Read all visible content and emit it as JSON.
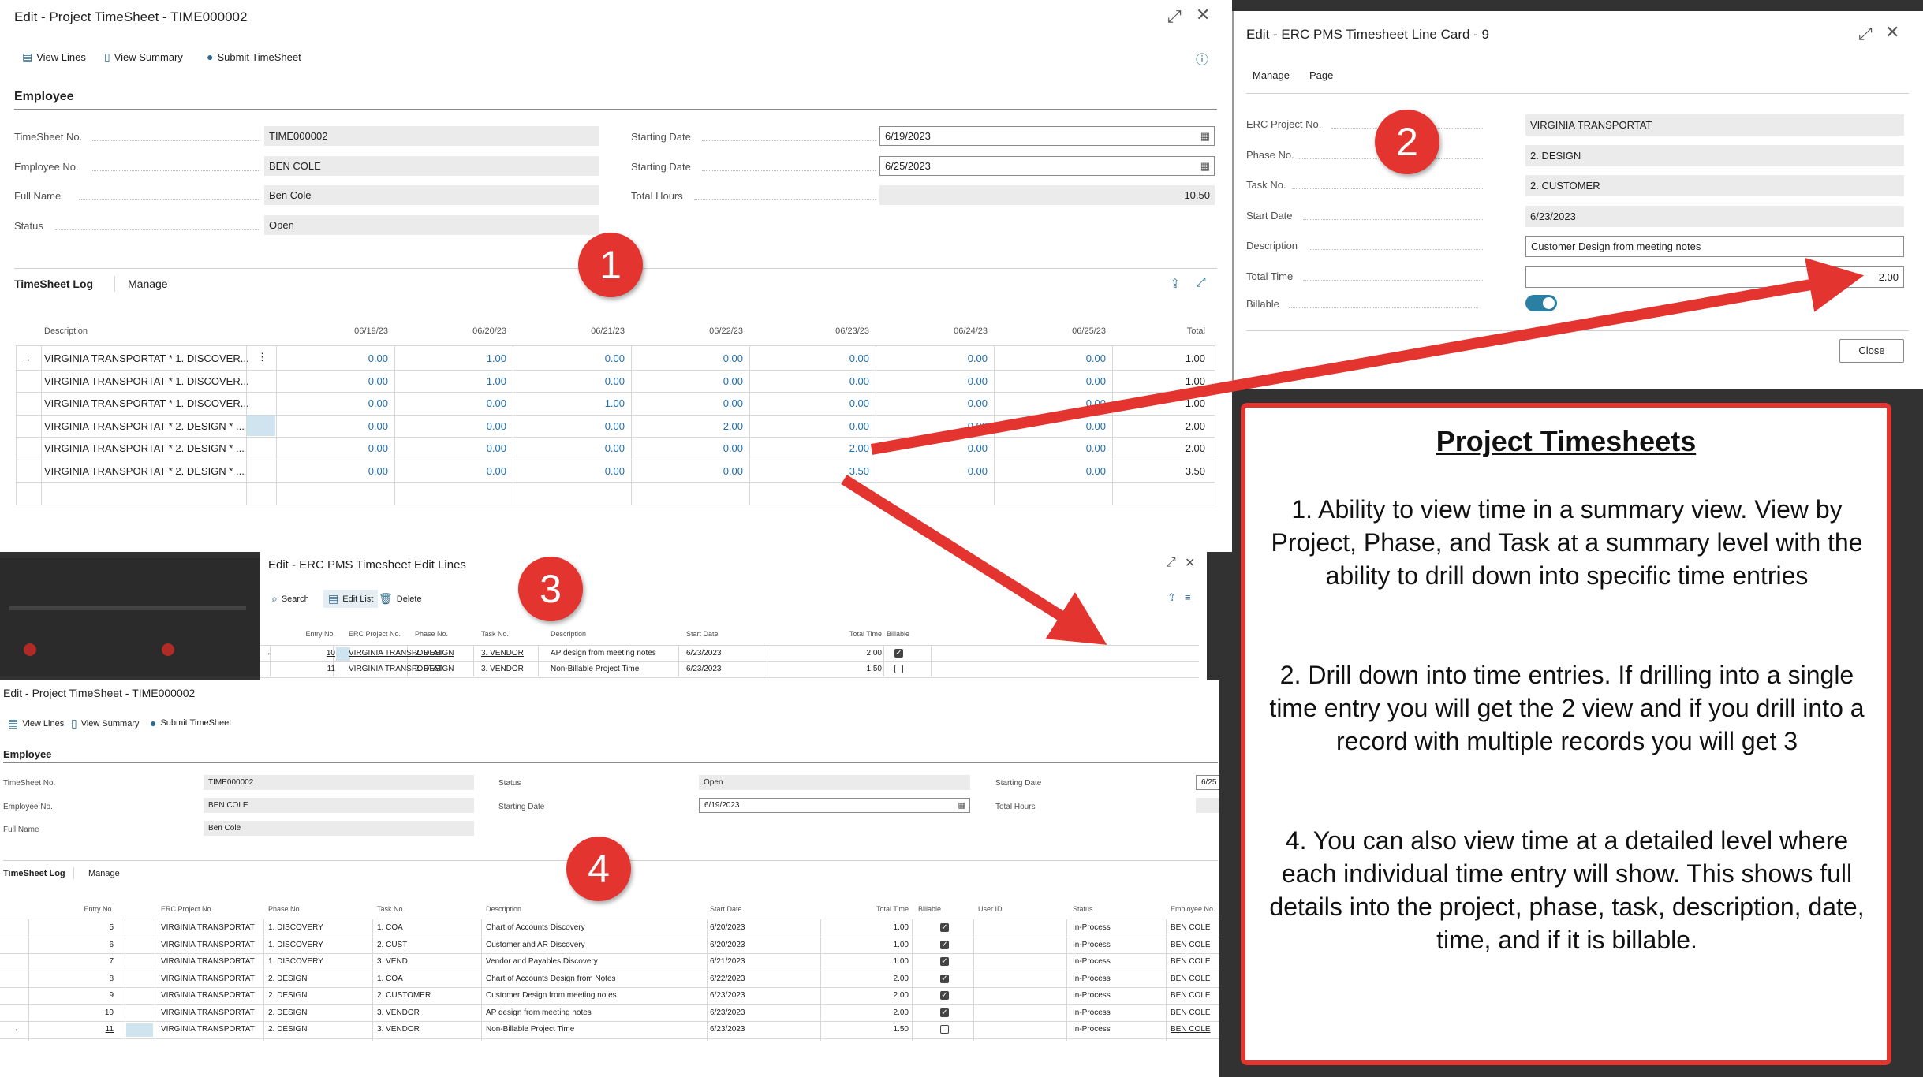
{
  "colors": {
    "accent": "#1f6fb0",
    "badge": "#e3342f",
    "toggle": "#2b7fa3",
    "background": "#323232"
  },
  "panel1": {
    "title": "Edit - Project TimeSheet - TIME000002",
    "actions": [
      "View Lines",
      "View Summary",
      "Submit TimeSheet"
    ],
    "section": "Employee",
    "fields": {
      "timesheet_no_label": "TimeSheet No.",
      "timesheet_no": "TIME000002",
      "employee_no_label": "Employee No.",
      "employee_no": "BEN COLE",
      "full_name_label": "Full Name",
      "full_name": "Ben Cole",
      "status_label": "Status",
      "status": "Open",
      "start1_label": "Starting Date",
      "start1": "6/19/2023",
      "start2_label": "Starting Date",
      "start2": "6/25/2023",
      "total_hours_label": "Total Hours",
      "total_hours": "10.50"
    },
    "tabs": [
      "TimeSheet Log",
      "Manage"
    ],
    "columns": [
      "Description",
      "06/19/23",
      "06/20/23",
      "06/21/23",
      "06/22/23",
      "06/23/23",
      "06/24/23",
      "06/25/23",
      "Total"
    ],
    "rows": [
      {
        "d": "VIRGINIA TRANSPORTAT * 1. DISCOVER...",
        "v": [
          "0.00",
          "1.00",
          "0.00",
          "0.00",
          "0.00",
          "0.00",
          "0.00"
        ],
        "t": "1.00"
      },
      {
        "d": "VIRGINIA TRANSPORTAT * 1. DISCOVER...",
        "v": [
          "0.00",
          "1.00",
          "0.00",
          "0.00",
          "0.00",
          "0.00",
          "0.00"
        ],
        "t": "1.00"
      },
      {
        "d": "VIRGINIA TRANSPORTAT * 1. DISCOVER...",
        "v": [
          "0.00",
          "0.00",
          "1.00",
          "0.00",
          "0.00",
          "0.00",
          "0.00"
        ],
        "t": "1.00"
      },
      {
        "d": "VIRGINIA TRANSPORTAT * 2. DESIGN * ...",
        "v": [
          "0.00",
          "0.00",
          "0.00",
          "2.00",
          "0.00",
          "0.00",
          "0.00"
        ],
        "t": "2.00"
      },
      {
        "d": "VIRGINIA TRANSPORTAT * 2. DESIGN * ...",
        "v": [
          "0.00",
          "0.00",
          "0.00",
          "0.00",
          "2.00",
          "0.00",
          "0.00"
        ],
        "t": "2.00"
      },
      {
        "d": "VIRGINIA TRANSPORTAT * 2. DESIGN * ...",
        "v": [
          "0.00",
          "0.00",
          "0.00",
          "0.00",
          "3.50",
          "0.00",
          "0.00"
        ],
        "t": "3.50"
      }
    ]
  },
  "panel2": {
    "title": "Edit - ERC PMS Timesheet Line Card - 9",
    "actions": [
      "Manage",
      "Page"
    ],
    "fields": [
      {
        "label": "ERC Project No.",
        "value": "VIRGINIA TRANSPORTAT"
      },
      {
        "label": "Phase No.",
        "value": "2. DESIGN"
      },
      {
        "label": "Task No.",
        "value": "2. CUSTOMER"
      },
      {
        "label": "Start Date",
        "value": "6/23/2023"
      },
      {
        "label": "Description",
        "value": "Customer Design from meeting notes"
      },
      {
        "label": "Total Time",
        "value": "2.00"
      }
    ],
    "billable_label": "Billable",
    "billable": true,
    "close": "Close"
  },
  "panel3": {
    "title": "Edit - ERC PMS Timesheet Edit Lines",
    "actions": [
      "Search",
      "Edit List",
      "Delete"
    ],
    "columns": [
      "Entry No.",
      "ERC Project No.",
      "Phase No.",
      "Task No.",
      "Description",
      "Start Date",
      "Total Time",
      "Billable"
    ],
    "rows": [
      {
        "entry": "10",
        "project": "VIRGINIA TRANSPORTAT",
        "phase": "2. DESIGN",
        "task": "3. VENDOR",
        "desc": "AP design from meeting notes",
        "date": "6/23/2023",
        "time": "2.00",
        "billable": true
      },
      {
        "entry": "11",
        "project": "VIRGINIA TRANSPORTAT",
        "phase": "2. DESIGN",
        "task": "3. VENDOR",
        "desc": "Non-Billable Project Time",
        "date": "6/23/2023",
        "time": "1.50",
        "billable": false
      }
    ]
  },
  "panel4": {
    "title": "Edit - Project TimeSheet - TIME000002",
    "actions": [
      "View Lines",
      "View Summary",
      "Submit TimeSheet"
    ],
    "section": "Employee",
    "fields": {
      "timesheet_no_label": "TimeSheet No.",
      "timesheet_no": "TIME000002",
      "employee_no_label": "Employee No.",
      "employee_no": "BEN COLE",
      "full_name_label": "Full Name",
      "full_name": "Ben Cole",
      "status_label": "Status",
      "status": "Open",
      "start_label": "Starting Date",
      "start": "6/19/2023",
      "start2_label": "Starting Date",
      "start2": "6/25",
      "total_hours_label": "Total Hours"
    },
    "tabs": [
      "TimeSheet Log",
      "Manage"
    ],
    "columns": [
      "Entry No.",
      "ERC Project No.",
      "Phase No.",
      "Task No.",
      "Description",
      "Start Date",
      "Total Time",
      "Billable",
      "User ID",
      "Status",
      "Employee No."
    ],
    "rows": [
      {
        "entry": "5",
        "project": "VIRGINIA TRANSPORTAT",
        "phase": "1. DISCOVERY",
        "task": "1. COA",
        "desc": "Chart of Accounts Discovery",
        "date": "6/20/2023",
        "time": "1.00",
        "billable": true,
        "status": "In-Process",
        "emp": "BEN COLE"
      },
      {
        "entry": "6",
        "project": "VIRGINIA TRANSPORTAT",
        "phase": "1. DISCOVERY",
        "task": "2. CUST",
        "desc": "Customer and AR Discovery",
        "date": "6/20/2023",
        "time": "1.00",
        "billable": true,
        "status": "In-Process",
        "emp": "BEN COLE"
      },
      {
        "entry": "7",
        "project": "VIRGINIA TRANSPORTAT",
        "phase": "1. DISCOVERY",
        "task": "3. VEND",
        "desc": "Vendor and Payables Discovery",
        "date": "6/21/2023",
        "time": "1.00",
        "billable": true,
        "status": "In-Process",
        "emp": "BEN COLE"
      },
      {
        "entry": "8",
        "project": "VIRGINIA TRANSPORTAT",
        "phase": "2. DESIGN",
        "task": "1. COA",
        "desc": "Chart of Accounts Design from Notes",
        "date": "6/22/2023",
        "time": "2.00",
        "billable": true,
        "status": "In-Process",
        "emp": "BEN COLE"
      },
      {
        "entry": "9",
        "project": "VIRGINIA TRANSPORTAT",
        "phase": "2. DESIGN",
        "task": "2. CUSTOMER",
        "desc": "Customer Design from meeting notes",
        "date": "6/23/2023",
        "time": "2.00",
        "billable": true,
        "status": "In-Process",
        "emp": "BEN COLE"
      },
      {
        "entry": "10",
        "project": "VIRGINIA TRANSPORTAT",
        "phase": "2. DESIGN",
        "task": "3. VENDOR",
        "desc": "AP design from meeting notes",
        "date": "6/23/2023",
        "time": "2.00",
        "billable": true,
        "status": "In-Process",
        "emp": "BEN COLE"
      },
      {
        "entry": "11",
        "project": "VIRGINIA TRANSPORTAT",
        "phase": "2. DESIGN",
        "task": "3. VENDOR",
        "desc": "Non-Billable Project Time",
        "date": "6/23/2023",
        "time": "1.50",
        "billable": false,
        "status": "In-Process",
        "emp": "BEN COLE"
      }
    ]
  },
  "badges": [
    "1",
    "2",
    "3",
    "4"
  ],
  "note": {
    "title": "Project Timesheets",
    "p1": "1. Ability to view time in a summary view. View by Project, Phase, and Task at a summary level with the ability to drill down into specific time entries",
    "p2": "2. Drill down into time entries. If drilling into a single time entry you will get the 2 view and if you drill into a record with multiple records you will get 3",
    "p3": "4. You can also view time at a detailed level where each individual time entry will show. This shows full details into the project, phase, task, description, date, time, and if it is billable."
  }
}
